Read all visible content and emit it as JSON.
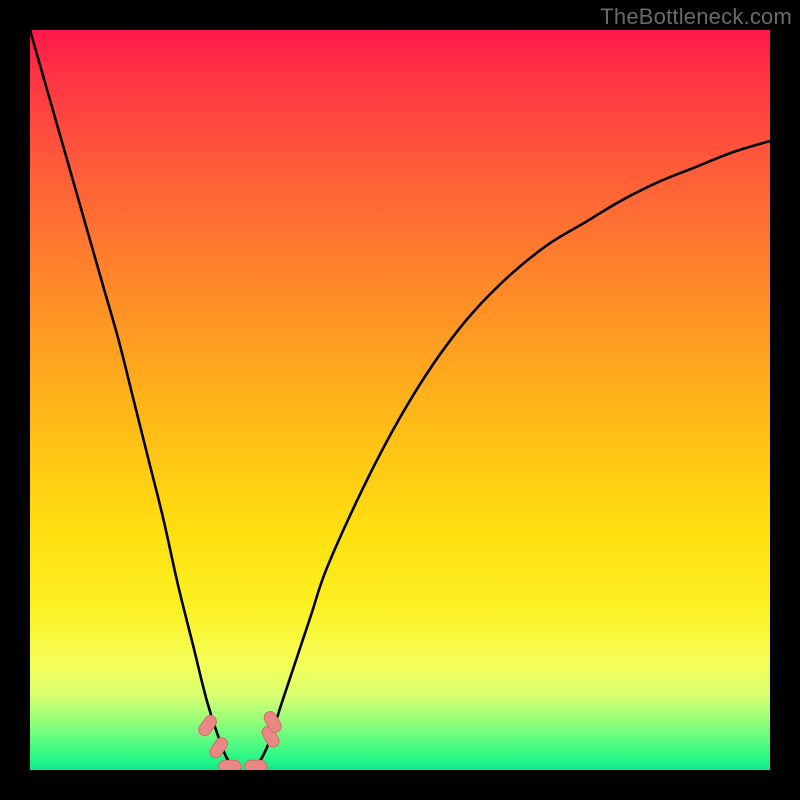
{
  "watermark": "TheBottleneck.com",
  "colors": {
    "frame": "#000000",
    "curve_stroke": "#000000",
    "marker_fill": "#e98884",
    "marker_stroke": "#d76b67"
  },
  "chart_data": {
    "type": "line",
    "title": "",
    "xlabel": "",
    "ylabel": "",
    "xlim": [
      0,
      100
    ],
    "ylim": [
      0,
      100
    ],
    "x": [
      0,
      2,
      4,
      6,
      8,
      10,
      12,
      14,
      16,
      18,
      20,
      22,
      24,
      26,
      27,
      28,
      30,
      32,
      34,
      36,
      38,
      40,
      44,
      48,
      52,
      56,
      60,
      65,
      70,
      75,
      80,
      85,
      90,
      95,
      100
    ],
    "values": [
      100,
      93,
      86,
      79,
      72,
      65,
      58,
      50,
      42,
      34,
      25,
      17,
      9,
      3,
      1,
      0,
      0,
      3,
      9,
      15,
      21,
      27,
      36,
      44,
      51,
      57,
      62,
      67,
      71,
      74,
      77,
      79.5,
      81.5,
      83.5,
      85
    ],
    "markers": [
      {
        "x": 24.0,
        "y": 6.0
      },
      {
        "x": 25.5,
        "y": 3.0
      },
      {
        "x": 27.0,
        "y": 0.5
      },
      {
        "x": 30.5,
        "y": 0.5
      },
      {
        "x": 32.5,
        "y": 4.5
      },
      {
        "x": 32.8,
        "y": 6.5
      }
    ]
  }
}
